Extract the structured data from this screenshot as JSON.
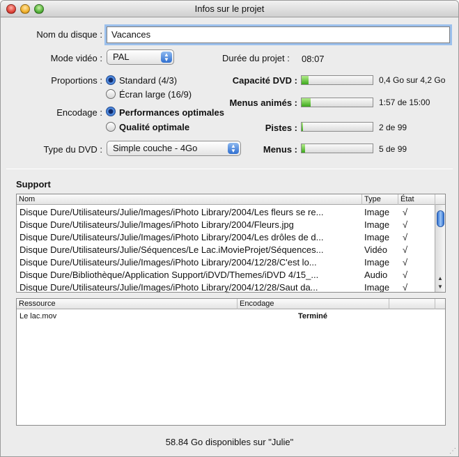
{
  "window": {
    "title": "Infos sur le projet"
  },
  "form": {
    "disc_name_label": "Nom du disque :",
    "disc_name_value": "Vacances",
    "video_mode_label": "Mode vidéo :",
    "video_mode_value": "PAL",
    "duration_label": "Durée du projet :",
    "duration_value": "08:07",
    "aspect_label": "Proportions :",
    "aspect_options": [
      "Standard (4/3)",
      "Écran large (16/9)"
    ],
    "aspect_selected": 0,
    "encoding_label": "Encodage :",
    "encoding_options": [
      "Performances optimales",
      "Qualité optimale"
    ],
    "encoding_selected": 0,
    "dvd_type_label": "Type du DVD :",
    "dvd_type_value": "Simple couche - 4Go"
  },
  "meters": [
    {
      "label": "Capacité DVD :",
      "value_text": "0,4 Go sur 4,2 Go",
      "fraction": 0.095
    },
    {
      "label": "Menus animés :",
      "value_text": "1:57 de 15:00",
      "fraction": 0.13
    },
    {
      "label": "Pistes :",
      "value_text": "2 de 99",
      "fraction": 0.02
    },
    {
      "label": "Menus :",
      "value_text": "5 de 99",
      "fraction": 0.05
    }
  ],
  "support": {
    "title": "Support",
    "columns": [
      "Nom",
      "Type",
      "État"
    ],
    "rows": [
      {
        "name": "Disque Dure/Utilisateurs/Julie/Images/iPhoto Library/2004/Les fleurs se re...",
        "type": "Image",
        "state": "√"
      },
      {
        "name": "Disque Dure/Utilisateurs/Julie/Images/iPhoto Library/2004/Fleurs.jpg",
        "type": "Image",
        "state": "√"
      },
      {
        "name": "Disque Dure/Utilisateurs/Julie/Images/iPhoto Library/2004/Les drôles de d...",
        "type": "Image",
        "state": "√"
      },
      {
        "name": "Disque Dure/Utilisateurs/Julie/Séquences/Le Lac.iMovieProjet/Séquences...",
        "type": "Vidéo",
        "state": "√"
      },
      {
        "name": "Disque Dure/Utilisateurs/Julie/Images/iPhoto Library/2004/12/28/C'est lo...",
        "type": "Image",
        "state": "√"
      },
      {
        "name": "Disque Dure/Bibliothèque/Application Support/iDVD/Themes/iDVD 4/15_...",
        "type": "Audio",
        "state": "√"
      },
      {
        "name": "Disque Dure/Utilisateurs/Julie/Images/iPhoto Library/2004/12/28/Saut da...",
        "type": "Image",
        "state": "√"
      }
    ]
  },
  "resources": {
    "columns": [
      "Ressource",
      "Encodage"
    ],
    "rows": [
      {
        "name": "Le lac.mov",
        "encoding": "Terminé"
      }
    ]
  },
  "footer": {
    "free_space": "58.84  Go disponibles sur \"Julie\""
  },
  "colors": {
    "accent": "#2f6fd0",
    "meter_green": "#3ca81c",
    "focus_ring": "#9cc0ec"
  }
}
